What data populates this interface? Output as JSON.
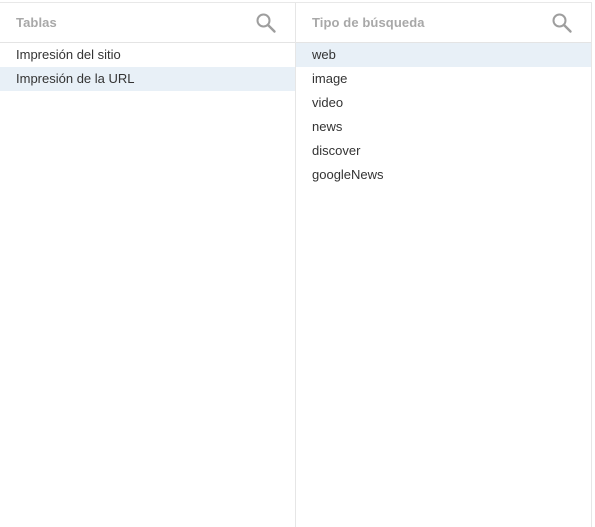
{
  "colors": {
    "selected_background": "#e8f0f7",
    "header_text": "#a8a8a8",
    "item_text": "#333333",
    "divider": "#e6e6e6"
  },
  "left_panel": {
    "title": "Tablas",
    "search_icon": "search-icon",
    "items": [
      {
        "label": "Impresión del sitio",
        "selected": false
      },
      {
        "label": "Impresión de la URL",
        "selected": true
      }
    ]
  },
  "right_panel": {
    "title": "Tipo de búsqueda",
    "search_icon": "search-icon",
    "items": [
      {
        "label": "web",
        "selected": true
      },
      {
        "label": "image",
        "selected": false
      },
      {
        "label": "video",
        "selected": false
      },
      {
        "label": "news",
        "selected": false
      },
      {
        "label": "discover",
        "selected": false
      },
      {
        "label": "googleNews",
        "selected": false
      }
    ]
  }
}
